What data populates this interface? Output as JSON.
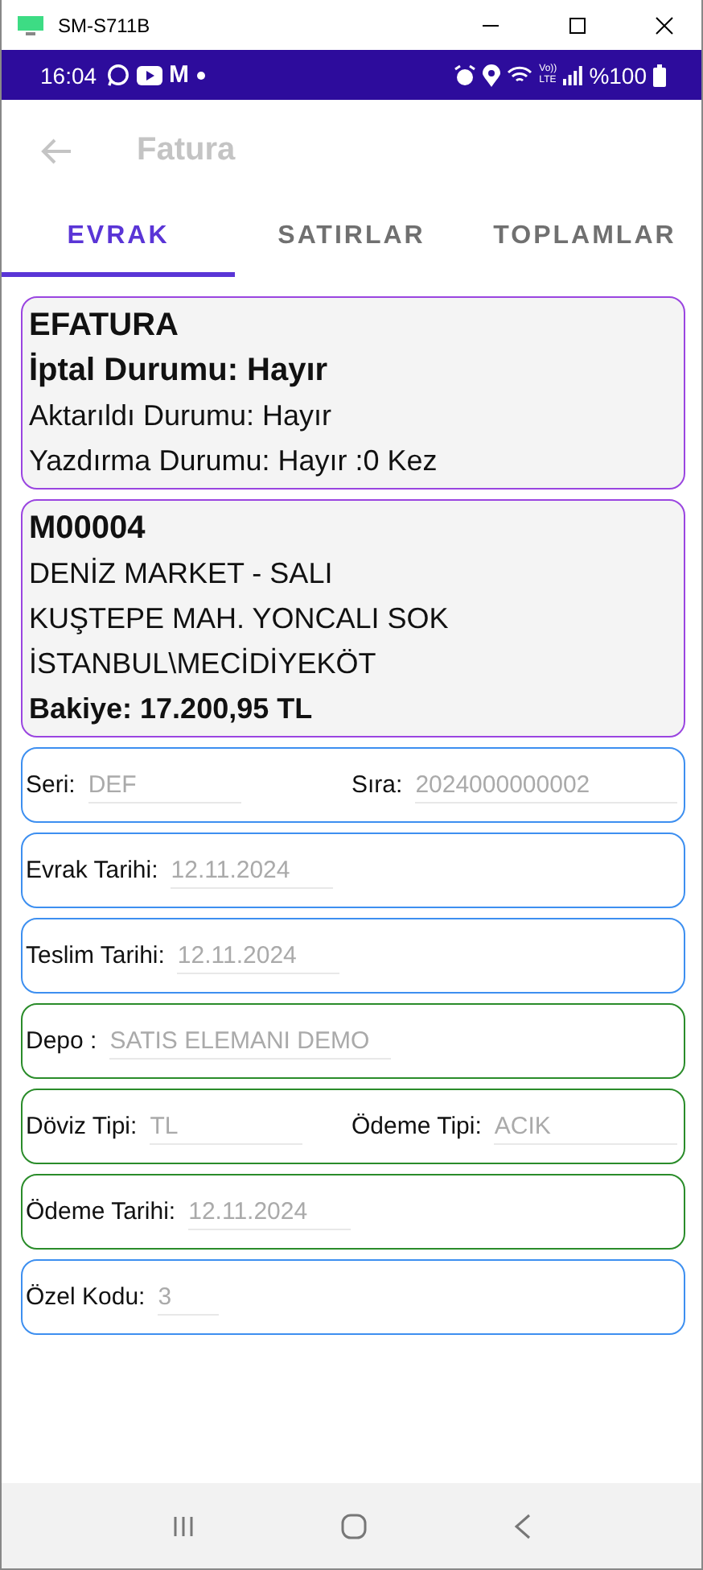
{
  "window": {
    "title": "SM-S711B"
  },
  "status_bar": {
    "time": "16:04",
    "app_letter": "M",
    "network_lines": [
      "Vo))",
      "LTE"
    ],
    "battery": "%100"
  },
  "app_bar": {
    "title": "Fatura"
  },
  "tabs": [
    {
      "label": "EVRAK",
      "selected": true
    },
    {
      "label": "SATIRLAR",
      "selected": false
    },
    {
      "label": "TOPLAMLAR",
      "selected": false
    }
  ],
  "info_cards": [
    {
      "lines": [
        {
          "text": "EFATURA",
          "kind": "heading"
        },
        {
          "text": "İptal Durumu: Hayır",
          "kind": "heading"
        },
        {
          "text": "Aktarıldı Durumu: Hayır",
          "kind": "plain"
        },
        {
          "text": "Yazdırma Durumu: Hayır :0 Kez",
          "kind": "plain"
        }
      ]
    },
    {
      "lines": [
        {
          "text": "M00004",
          "kind": "heading"
        },
        {
          "text": "DENİZ MARKET - SALI",
          "kind": "plain"
        },
        {
          "text": "KUŞTEPE MAH. YONCALI SOK",
          "kind": "plain"
        },
        {
          "text": "İSTANBUL\\MECİDİYEKÖT",
          "kind": "plain"
        },
        {
          "text": "Bakiye: 17.200,95 TL",
          "kind": "bold"
        }
      ]
    }
  ],
  "field_cards": [
    {
      "color": "#3d8ff0",
      "fields": [
        {
          "label": "Seri:",
          "value": "DEF"
        },
        {
          "label": "Sıra:",
          "value": "2024000000002"
        }
      ]
    },
    {
      "color": "#3d8ff0",
      "fields": [
        {
          "label": "Evrak Tarihi:",
          "value": "12.11.2024"
        }
      ]
    },
    {
      "color": "#3d8ff0",
      "fields": [
        {
          "label": "Teslim Tarihi:",
          "value": "12.11.2024"
        }
      ]
    },
    {
      "color": "#2a8c2a",
      "fields": [
        {
          "label": "Depo :",
          "value": "SATIS ELEMANI DEMO"
        }
      ]
    },
    {
      "color": "#2a8c2a",
      "fields": [
        {
          "label": "Döviz Tipi:",
          "value": "TL"
        },
        {
          "label": "Ödeme Tipi:",
          "value": "ACIK"
        }
      ]
    },
    {
      "color": "#2a8c2a",
      "fields": [
        {
          "label": "Ödeme Tarihi:",
          "value": "12.11.2024"
        }
      ]
    },
    {
      "color": "#3d8ff0",
      "fields": [
        {
          "label": "Özel Kodu:",
          "value": "3"
        }
      ]
    }
  ]
}
